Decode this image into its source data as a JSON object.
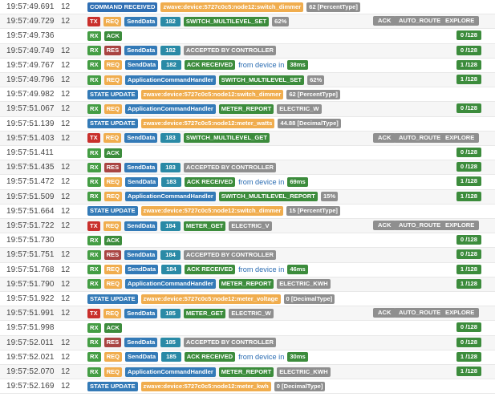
{
  "rows": [
    {
      "ts": "19:57:49.691",
      "node": "12",
      "tags": [
        {
          "t": "COMMAND RECEIVED",
          "c": "b-cmd"
        },
        {
          "t": "zwave:device:5727c0c5:node12:switch_dimmer",
          "c": "b-orange"
        },
        {
          "t": "62 [PercentType]",
          "c": "b-gray"
        }
      ],
      "right": [],
      "count": ""
    },
    {
      "ts": "19:57:49.729",
      "node": "12",
      "tags": [
        {
          "t": "TX",
          "c": "b-tx"
        },
        {
          "t": "REQ",
          "c": "b-req"
        },
        {
          "t": "SendData",
          "c": "b-fn"
        },
        {
          "t": "182",
          "c": "b-id num"
        },
        {
          "t": "SWITCH_MULTILEVEL_SET",
          "c": "b-green"
        },
        {
          "t": "62%",
          "c": "b-gray"
        }
      ],
      "right": [
        "ACK",
        "AUTO_ROUTE",
        "EXPLORE"
      ],
      "count": ""
    },
    {
      "ts": "19:57:49.736",
      "node": "",
      "tags": [
        {
          "t": "RX",
          "c": "b-rx"
        },
        {
          "t": "ACK",
          "c": "b-green"
        }
      ],
      "right": [],
      "count": "0 /128"
    },
    {
      "ts": "19:57:49.749",
      "node": "12",
      "tags": [
        {
          "t": "RX",
          "c": "b-rx"
        },
        {
          "t": "RES",
          "c": "b-res"
        },
        {
          "t": "SendData",
          "c": "b-fn"
        },
        {
          "t": "182",
          "c": "b-id num"
        },
        {
          "t": "ACCEPTED BY CONTROLLER",
          "c": "b-gray"
        }
      ],
      "right": [],
      "count": "0 /128"
    },
    {
      "ts": "19:57:49.767",
      "node": "12",
      "tags": [
        {
          "t": "RX",
          "c": "b-rx"
        },
        {
          "t": "REQ",
          "c": "b-req"
        },
        {
          "t": "SendData",
          "c": "b-fn"
        },
        {
          "t": "182",
          "c": "b-id num"
        },
        {
          "t": "ACK RECEIVED",
          "c": "b-green"
        },
        {
          "t": "from device in",
          "c": "plain"
        },
        {
          "t": "38ms",
          "c": "b-green"
        }
      ],
      "right": [],
      "count": "1 /128"
    },
    {
      "ts": "19:57:49.796",
      "node": "12",
      "tags": [
        {
          "t": "RX",
          "c": "b-rx"
        },
        {
          "t": "REQ",
          "c": "b-req"
        },
        {
          "t": "ApplicationCommandHandler",
          "c": "b-fn"
        },
        {
          "t": "SWITCH_MULTILEVEL_SET",
          "c": "b-green"
        },
        {
          "t": "62%",
          "c": "b-gray"
        }
      ],
      "right": [],
      "count": "1 /128"
    },
    {
      "ts": "19:57:49.982",
      "node": "12",
      "tags": [
        {
          "t": "STATE UPDATE",
          "c": "b-state"
        },
        {
          "t": "zwave:device:5727c0c5:node12:switch_dimmer",
          "c": "b-orange"
        },
        {
          "t": "62 [PercentType]",
          "c": "b-gray"
        }
      ],
      "right": [],
      "count": ""
    },
    {
      "ts": "19:57:51.067",
      "node": "12",
      "tags": [
        {
          "t": "RX",
          "c": "b-rx"
        },
        {
          "t": "REQ",
          "c": "b-req"
        },
        {
          "t": "ApplicationCommandHandler",
          "c": "b-fn"
        },
        {
          "t": "METER_REPORT",
          "c": "b-green"
        },
        {
          "t": "ELECTRIC_W",
          "c": "b-gray"
        }
      ],
      "right": [],
      "count": "0 /128"
    },
    {
      "ts": "19:57:51.139",
      "node": "12",
      "tags": [
        {
          "t": "STATE UPDATE",
          "c": "b-state"
        },
        {
          "t": "zwave:device:5727c0c5:node12:meter_watts",
          "c": "b-orange"
        },
        {
          "t": "44.88 [DecimalType]",
          "c": "b-gray"
        }
      ],
      "right": [],
      "count": ""
    },
    {
      "ts": "19:57:51.403",
      "node": "12",
      "tags": [
        {
          "t": "TX",
          "c": "b-tx"
        },
        {
          "t": "REQ",
          "c": "b-req"
        },
        {
          "t": "SendData",
          "c": "b-fn"
        },
        {
          "t": "183",
          "c": "b-id num"
        },
        {
          "t": "SWITCH_MULTILEVEL_GET",
          "c": "b-green"
        }
      ],
      "right": [
        "ACK",
        "AUTO_ROUTE",
        "EXPLORE"
      ],
      "count": ""
    },
    {
      "ts": "19:57:51.411",
      "node": "",
      "tags": [
        {
          "t": "RX",
          "c": "b-rx"
        },
        {
          "t": "ACK",
          "c": "b-green"
        }
      ],
      "right": [],
      "count": "0 /128"
    },
    {
      "ts": "19:57:51.435",
      "node": "12",
      "tags": [
        {
          "t": "RX",
          "c": "b-rx"
        },
        {
          "t": "RES",
          "c": "b-res"
        },
        {
          "t": "SendData",
          "c": "b-fn"
        },
        {
          "t": "183",
          "c": "b-id num"
        },
        {
          "t": "ACCEPTED BY CONTROLLER",
          "c": "b-gray"
        }
      ],
      "right": [],
      "count": "0 /128"
    },
    {
      "ts": "19:57:51.472",
      "node": "12",
      "tags": [
        {
          "t": "RX",
          "c": "b-rx"
        },
        {
          "t": "REQ",
          "c": "b-req"
        },
        {
          "t": "SendData",
          "c": "b-fn"
        },
        {
          "t": "183",
          "c": "b-id num"
        },
        {
          "t": "ACK RECEIVED",
          "c": "b-green"
        },
        {
          "t": "from device in",
          "c": "plain"
        },
        {
          "t": "69ms",
          "c": "b-green"
        }
      ],
      "right": [],
      "count": "1 /128"
    },
    {
      "ts": "19:57:51.509",
      "node": "12",
      "tags": [
        {
          "t": "RX",
          "c": "b-rx"
        },
        {
          "t": "REQ",
          "c": "b-req"
        },
        {
          "t": "ApplicationCommandHandler",
          "c": "b-fn"
        },
        {
          "t": "SWITCH_MULTILEVEL_REPORT",
          "c": "b-green"
        },
        {
          "t": "15%",
          "c": "b-gray"
        }
      ],
      "right": [],
      "count": "1 /128"
    },
    {
      "ts": "19:57:51.664",
      "node": "12",
      "tags": [
        {
          "t": "STATE UPDATE",
          "c": "b-state"
        },
        {
          "t": "zwave:device:5727c0c5:node12:switch_dimmer",
          "c": "b-orange"
        },
        {
          "t": "15 [PercentType]",
          "c": "b-gray"
        }
      ],
      "right": [],
      "count": ""
    },
    {
      "ts": "19:57:51.722",
      "node": "12",
      "tags": [
        {
          "t": "TX",
          "c": "b-tx"
        },
        {
          "t": "REQ",
          "c": "b-req"
        },
        {
          "t": "SendData",
          "c": "b-fn"
        },
        {
          "t": "184",
          "c": "b-id num"
        },
        {
          "t": "METER_GET",
          "c": "b-green"
        },
        {
          "t": "ELECTRIC_V",
          "c": "b-gray"
        }
      ],
      "right": [
        "ACK",
        "AUTO_ROUTE",
        "EXPLORE"
      ],
      "count": ""
    },
    {
      "ts": "19:57:51.730",
      "node": "",
      "tags": [
        {
          "t": "RX",
          "c": "b-rx"
        },
        {
          "t": "ACK",
          "c": "b-green"
        }
      ],
      "right": [],
      "count": "0 /128"
    },
    {
      "ts": "19:57:51.751",
      "node": "12",
      "tags": [
        {
          "t": "RX",
          "c": "b-rx"
        },
        {
          "t": "RES",
          "c": "b-res"
        },
        {
          "t": "SendData",
          "c": "b-fn"
        },
        {
          "t": "184",
          "c": "b-id num"
        },
        {
          "t": "ACCEPTED BY CONTROLLER",
          "c": "b-gray"
        }
      ],
      "right": [],
      "count": "0 /128"
    },
    {
      "ts": "19:57:51.768",
      "node": "12",
      "tags": [
        {
          "t": "RX",
          "c": "b-rx"
        },
        {
          "t": "REQ",
          "c": "b-req"
        },
        {
          "t": "SendData",
          "c": "b-fn"
        },
        {
          "t": "184",
          "c": "b-id num"
        },
        {
          "t": "ACK RECEIVED",
          "c": "b-green"
        },
        {
          "t": "from device in",
          "c": "plain"
        },
        {
          "t": "46ms",
          "c": "b-green"
        }
      ],
      "right": [],
      "count": "1 /128"
    },
    {
      "ts": "19:57:51.790",
      "node": "12",
      "tags": [
        {
          "t": "RX",
          "c": "b-rx"
        },
        {
          "t": "REQ",
          "c": "b-req"
        },
        {
          "t": "ApplicationCommandHandler",
          "c": "b-fn"
        },
        {
          "t": "METER_REPORT",
          "c": "b-green"
        },
        {
          "t": "ELECTRIC_KWH",
          "c": "b-gray"
        }
      ],
      "right": [],
      "count": "1 /128"
    },
    {
      "ts": "19:57:51.922",
      "node": "12",
      "tags": [
        {
          "t": "STATE UPDATE",
          "c": "b-state"
        },
        {
          "t": "zwave:device:5727c0c5:node12:meter_voltage",
          "c": "b-orange"
        },
        {
          "t": "0 [DecimalType]",
          "c": "b-gray"
        }
      ],
      "right": [],
      "count": ""
    },
    {
      "ts": "19:57:51.991",
      "node": "12",
      "tags": [
        {
          "t": "TX",
          "c": "b-tx"
        },
        {
          "t": "REQ",
          "c": "b-req"
        },
        {
          "t": "SendData",
          "c": "b-fn"
        },
        {
          "t": "185",
          "c": "b-id num"
        },
        {
          "t": "METER_GET",
          "c": "b-green"
        },
        {
          "t": "ELECTRIC_W",
          "c": "b-gray"
        }
      ],
      "right": [
        "ACK",
        "AUTO_ROUTE",
        "EXPLORE"
      ],
      "count": ""
    },
    {
      "ts": "19:57:51.998",
      "node": "",
      "tags": [
        {
          "t": "RX",
          "c": "b-rx"
        },
        {
          "t": "ACK",
          "c": "b-green"
        }
      ],
      "right": [],
      "count": "0 /128"
    },
    {
      "ts": "19:57:52.011",
      "node": "12",
      "tags": [
        {
          "t": "RX",
          "c": "b-rx"
        },
        {
          "t": "RES",
          "c": "b-res"
        },
        {
          "t": "SendData",
          "c": "b-fn"
        },
        {
          "t": "185",
          "c": "b-id num"
        },
        {
          "t": "ACCEPTED BY CONTROLLER",
          "c": "b-gray"
        }
      ],
      "right": [],
      "count": "0 /128"
    },
    {
      "ts": "19:57:52.021",
      "node": "12",
      "tags": [
        {
          "t": "RX",
          "c": "b-rx"
        },
        {
          "t": "REQ",
          "c": "b-req"
        },
        {
          "t": "SendData",
          "c": "b-fn"
        },
        {
          "t": "185",
          "c": "b-id num"
        },
        {
          "t": "ACK RECEIVED",
          "c": "b-green"
        },
        {
          "t": "from device in",
          "c": "plain"
        },
        {
          "t": "30ms",
          "c": "b-green"
        }
      ],
      "right": [],
      "count": "1 /128"
    },
    {
      "ts": "19:57:52.070",
      "node": "12",
      "tags": [
        {
          "t": "RX",
          "c": "b-rx"
        },
        {
          "t": "REQ",
          "c": "b-req"
        },
        {
          "t": "ApplicationCommandHandler",
          "c": "b-fn"
        },
        {
          "t": "METER_REPORT",
          "c": "b-green"
        },
        {
          "t": "ELECTRIC_KWH",
          "c": "b-gray"
        }
      ],
      "right": [],
      "count": "1 /128"
    },
    {
      "ts": "19:57:52.169",
      "node": "12",
      "tags": [
        {
          "t": "STATE UPDATE",
          "c": "b-state"
        },
        {
          "t": "zwave:device:5727c0c5:node12:meter_kwh",
          "c": "b-orange"
        },
        {
          "t": "0 [DecimalType]",
          "c": "b-gray"
        }
      ],
      "right": [],
      "count": ""
    }
  ]
}
